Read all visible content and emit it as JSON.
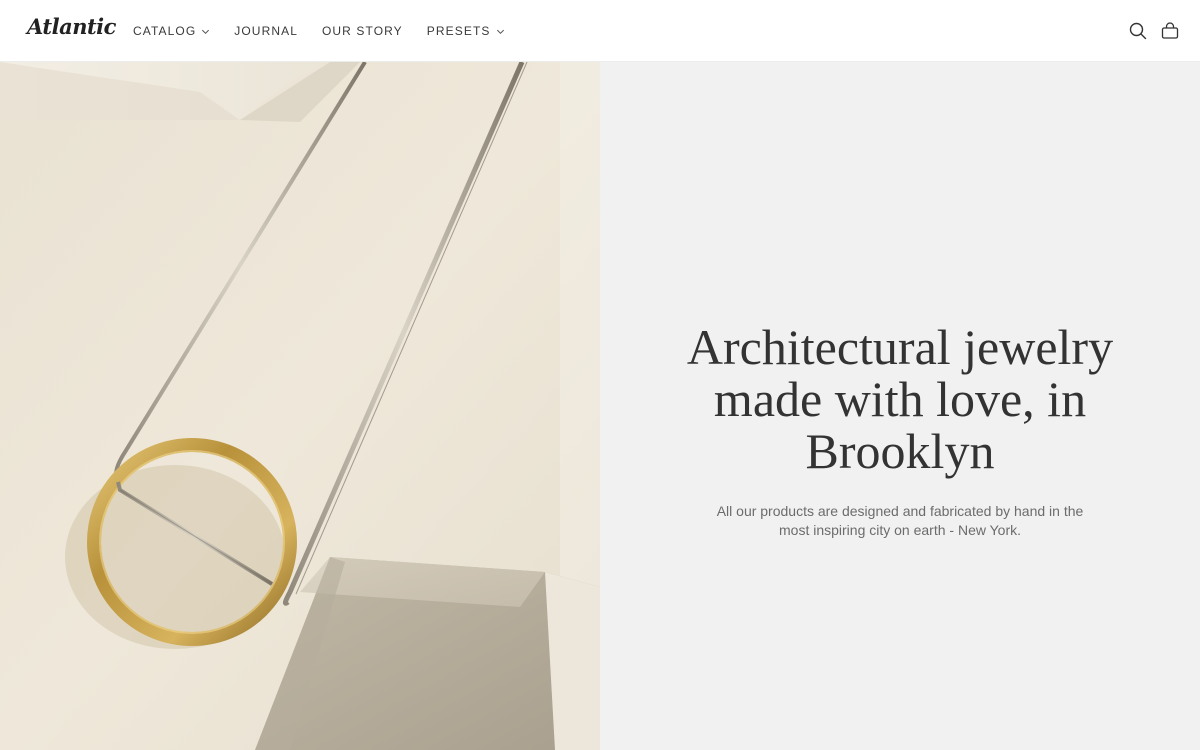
{
  "brand": {
    "logo_text": "Atlantic"
  },
  "nav": {
    "items": [
      {
        "label": "CATALOG",
        "has_dropdown": true
      },
      {
        "label": "JOURNAL",
        "has_dropdown": false
      },
      {
        "label": "OUR STORY",
        "has_dropdown": false
      },
      {
        "label": "PRESETS",
        "has_dropdown": true
      }
    ]
  },
  "header_icons": [
    "search-icon",
    "shopping-bag-icon"
  ],
  "hero": {
    "image_description": "Gold circular pendant with bar on snake chain draped over cream geometric blocks",
    "headline": "Architectural jewelry made with love, in Brooklyn",
    "subtext": "All our products are designed and fabricated by hand in the most inspiring city on earth - New York."
  },
  "colors": {
    "text_panel_bg": "#f1f1f1",
    "headline": "#333333",
    "subtext": "#6c6c6c",
    "header_bg": "#ffffff",
    "image_cream": "#ece5d7",
    "gold": "#b8913a"
  }
}
